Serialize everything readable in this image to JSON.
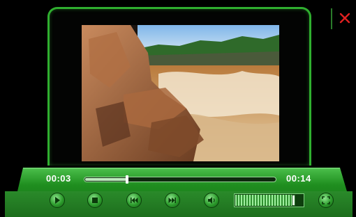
{
  "player": {
    "current_time": "00:03",
    "total_time": "00:14",
    "progress": 0.22,
    "volume": 0.86
  },
  "controls": [
    {
      "name": "play-button",
      "icon": "play-icon"
    },
    {
      "name": "stop-button",
      "icon": "stop-icon"
    },
    {
      "name": "rewind-button",
      "icon": "rewind-icon"
    },
    {
      "name": "fast-forward-button",
      "icon": "fast-forward-icon"
    },
    {
      "name": "mute-button",
      "icon": "speaker-icon"
    },
    {
      "name": "fullscreen-button",
      "icon": "fullscreen-icon"
    }
  ],
  "close": {
    "icon": "close-icon",
    "color": "#e02020"
  },
  "colors": {
    "accent": "#2fae2f",
    "bar": "#1f7a1f",
    "background": "#000000"
  }
}
